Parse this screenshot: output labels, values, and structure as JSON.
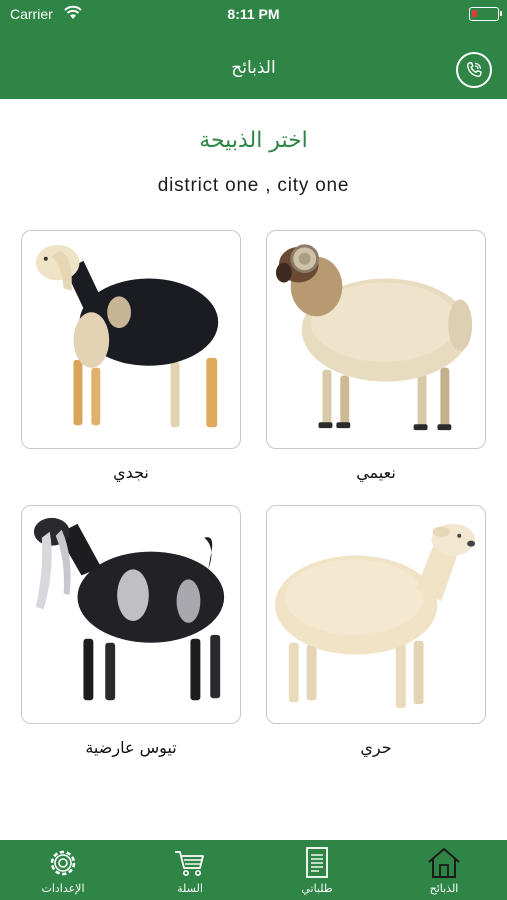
{
  "status_bar": {
    "carrier": "Carrier",
    "time": "8:11 PM",
    "battery_color": "#e53935"
  },
  "nav": {
    "title": "الذبائح",
    "call_icon": "phone-icon"
  },
  "main": {
    "heading": "اختر الذبيحة",
    "location": "district one , city one",
    "items": [
      {
        "label": "نعيمي",
        "image": "naeemi-sheep"
      },
      {
        "label": "نجدي",
        "image": "najdi-sheep"
      },
      {
        "label": "حري",
        "image": "harri-sheep"
      },
      {
        "label": "تيوس عارضية",
        "image": "aradi-goat"
      }
    ]
  },
  "tab_bar": {
    "tabs": [
      {
        "label": "الذبائح",
        "icon": "home-icon"
      },
      {
        "label": "طلباتي",
        "icon": "orders-icon"
      },
      {
        "label": "السلة",
        "icon": "cart-icon"
      },
      {
        "label": "الإعدادات",
        "icon": "gear-icon"
      }
    ]
  },
  "colors": {
    "primary": "#2e8545",
    "heading": "#2e8545",
    "card_border": "#c8c8c8"
  }
}
